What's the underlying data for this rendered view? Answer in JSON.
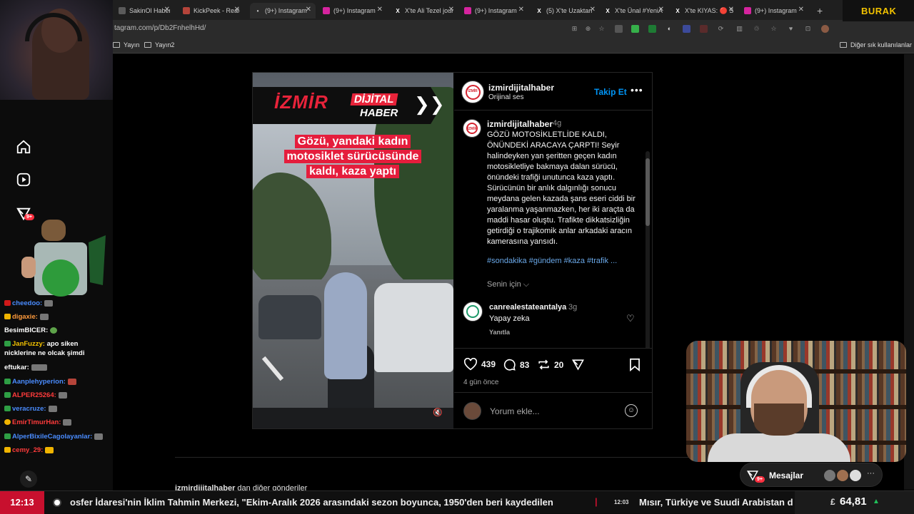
{
  "browser": {
    "tabs": [
      {
        "label": "SakinOl Haber M",
        "fav_color": "#5b5b5b",
        "fav_char": ""
      },
      {
        "label": "KickPeek - Real-t",
        "fav_color": "#b5443a",
        "fav_char": ""
      },
      {
        "label": "(9+) Instagram",
        "fav_color": "#2b2b2b",
        "fav_char": "•"
      },
      {
        "label": "(9+) Instagram",
        "fav_color": "#d6249f",
        "fav_char": ""
      },
      {
        "label": "X'te Ali Tezel jour",
        "fav_color": "#000000",
        "fav_char": "X"
      },
      {
        "label": "(9+) Instagram",
        "fav_color": "#d6249f",
        "fav_char": ""
      },
      {
        "label": "(5) X'te Uzaktan",
        "fav_color": "#000000",
        "fav_char": "X"
      },
      {
        "label": "X'te Ünal #YeniA",
        "fav_color": "#000000",
        "fav_char": "X"
      },
      {
        "label": "X'te KIYAS: 🔴 S",
        "fav_color": "#000000",
        "fav_char": "X"
      },
      {
        "label": "(9+) Instagram",
        "fav_color": "#d6249f",
        "fav_char": ""
      }
    ],
    "new_tab": "+",
    "url": "tagram.com/p/Db2FnhelhHd/",
    "bookmarks": [
      "Yayın",
      "Yayın2"
    ],
    "other_bookmarks": "Diğer sık kullanılanlar"
  },
  "post": {
    "banner_word1": "İZMİR",
    "banner_word2": "DİJİTAL",
    "banner_word3": "HABER",
    "banner_chevrons": "❯❯",
    "headline": "Gözü, yandaki kadın motosiklet sürücüsünde kaldı, kaza yaptı",
    "logo_text": "İZMİR",
    "header_user": "izmirdijitalhaber",
    "header_audio": "Orijinal ses",
    "follow": "Takip Et",
    "more": "•••",
    "caption_user": "izmirdijitalhaber",
    "caption_time": "4g",
    "caption_text": "GÖZÜ MOTOSİKLETLİDE KALDI, ÖNÜNDEKİ ARACAYA ÇARPTI! Seyir halindeyken yan şeritten geçen kadın motosikletliye bakmaya dalan sürücü, önündeki trafiği unutunca kaza yaptı. Sürücünün bir anlık dalgınlığı sonucu meydana gelen kazada şans eseri ciddi bir yaralanma yaşanmazken, her iki araçta da maddi hasar oluştu. Trafikte dikkatsizliğin getirdiği o trajikomik anlar arkadaki aracın kamerasına yansıdı.",
    "caption_tags": "#sondakika #gündem #kaza #trafik ...",
    "for_you": "Senin için ⌵",
    "comment": {
      "user": "canrealestateantalya",
      "time": "3g",
      "text": "Yapay zeka",
      "reply": "Yanıtla"
    },
    "likes": "439",
    "comments": "83",
    "reposts": "20",
    "ago": "4 gün önce",
    "comment_placeholder": "Yorum ekle...",
    "more_posts_user": "izmirdijitalhaber",
    "more_posts_suffix": " dan diğer gönderiler"
  },
  "overlay": {
    "brand": "BURAK",
    "messages_label": "Mesajlar",
    "messages_badge": "9+",
    "nav_badge": "9+",
    "more_dots": "···"
  },
  "chat": [
    {
      "user": "cheedoo:",
      "color": "#4a8cff",
      "msg": "",
      "badge": "#d01919"
    },
    {
      "user": "digaxie:",
      "color": "#ff9b3d",
      "msg": "",
      "badge": "#f0b400"
    },
    {
      "user": "BesimBICER:",
      "color": "#ffffff",
      "msg": "",
      "badge": ""
    },
    {
      "user": "JanFuzzy:",
      "color": "#f2c200",
      "msg": "apo siken",
      "badge": "#2e9e44"
    },
    {
      "user": "",
      "color": "#ffffff",
      "msg": "nicklerine ne olcak şimdi",
      "badge": ""
    },
    {
      "user": "eftukar:",
      "color": "#ffffff",
      "msg": "",
      "badge": ""
    },
    {
      "user": "Aanplehyperion:",
      "color": "#4a8cff",
      "msg": "",
      "badge": "#2e9e44"
    },
    {
      "user": "ALPER25264:",
      "color": "#ff3b3b",
      "msg": "",
      "badge": "#2e9e44"
    },
    {
      "user": "veracruze:",
      "color": "#4a8cff",
      "msg": "",
      "badge": "#2e9e44"
    },
    {
      "user": "EmirTimurHan:",
      "color": "#ff3b3b",
      "msg": "",
      "badge": "#f0b400"
    },
    {
      "user": "AlperBixileCagolayanlar:",
      "color": "#4a8cff",
      "msg": "",
      "badge": "#2e9e44"
    },
    {
      "user": "cemy_29:",
      "color": "#ff3b3b",
      "msg": "",
      "badge": "#f0b400"
    }
  ],
  "ticker": {
    "time": "12:13",
    "text": "osfer İdaresi'nin İklim Tahmin Merkezi, \"Ekim-Aralık 2026 arasındaki sezon boyunca, 1950'den beri kaydedilen",
    "sep": "|",
    "time2": "12:03",
    "text2": "Mısır, Türkiye ve Suudi Arabistan d",
    "fx_label": "£",
    "fx_value": "64,81",
    "fx_dir": "▲"
  },
  "colors": {
    "accent": "#0095f6",
    "ig_red": "#ff3040",
    "ticker_red": "#c8102e"
  }
}
